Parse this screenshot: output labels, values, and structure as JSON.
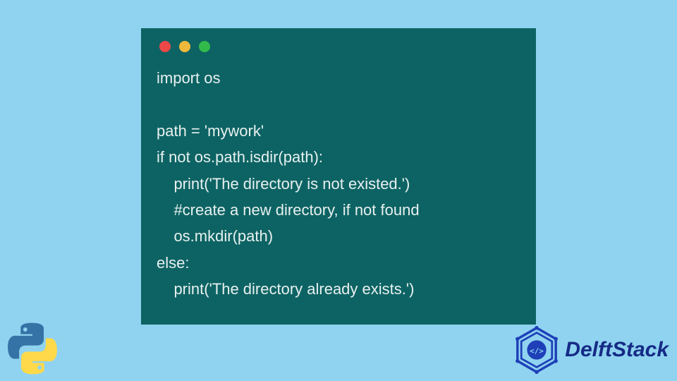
{
  "code": {
    "lines": [
      "import os",
      "",
      "path = 'mywork'",
      "if not os.path.isdir(path):",
      "    print('The directory is not existed.')",
      "    #create a new directory, if not found",
      "    os.mkdir(path)",
      "else:",
      "    print('The directory already exists.')"
    ]
  },
  "brand": {
    "name": "DelftStack"
  },
  "icons": {
    "python": "python-icon",
    "brand": "delftstack-icon"
  }
}
